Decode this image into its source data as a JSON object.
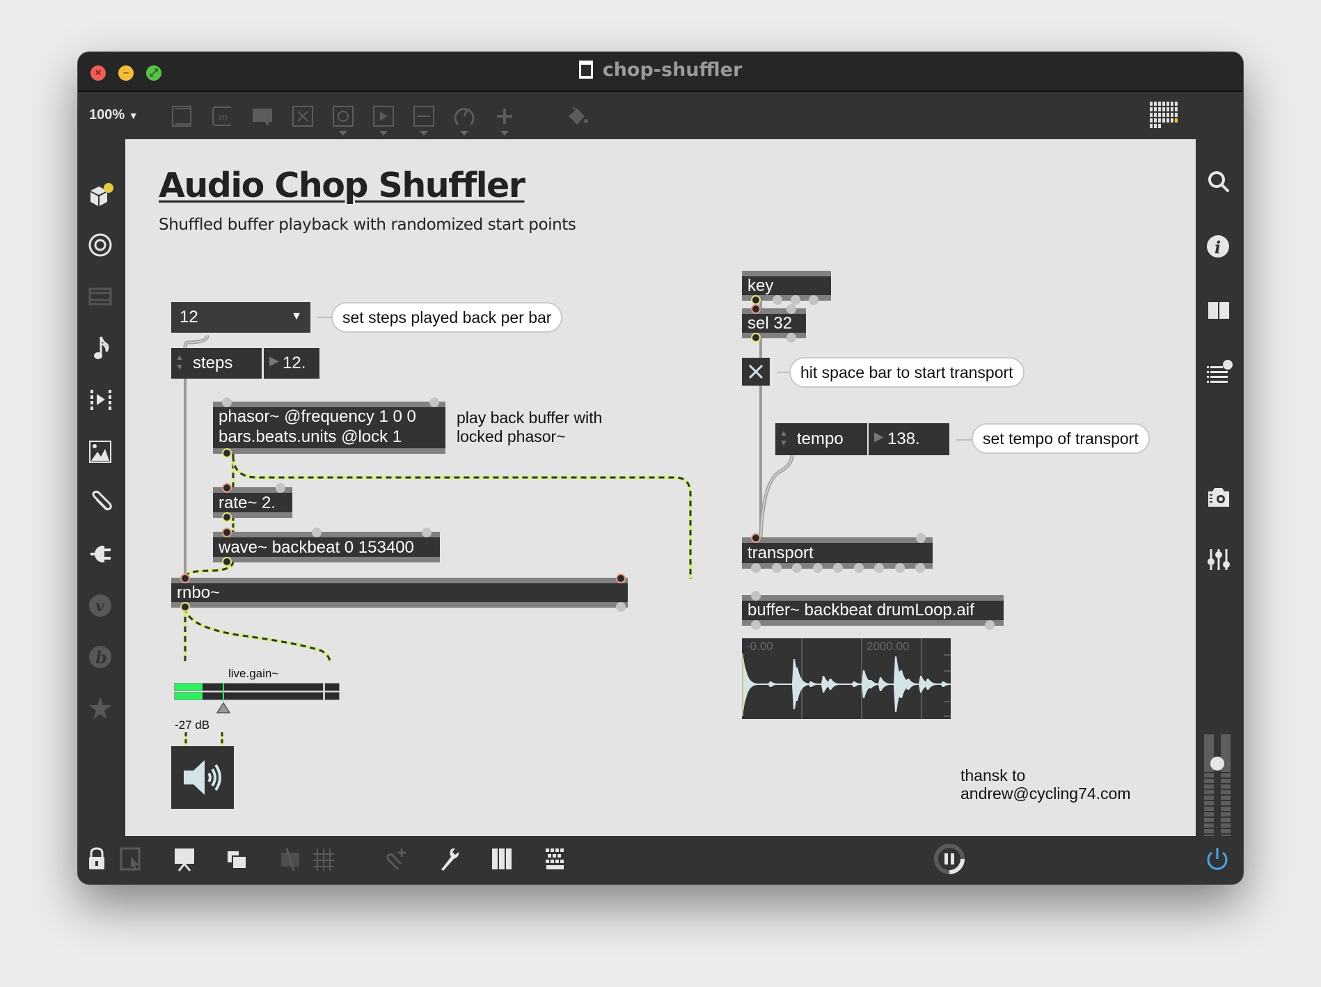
{
  "window": {
    "title": "chop-shuffler",
    "zoom": "100%"
  },
  "toolbar": {
    "icons": [
      "new-object-icon",
      "message-icon",
      "comment-icon",
      "toggle-icon",
      "button-icon",
      "number-icon",
      "slider-icon",
      "dial-icon",
      "add-icon",
      "paint-bucket-icon",
      "grid-icon"
    ]
  },
  "left_sidebar": {
    "icons": [
      "packages-icon",
      "target-icon",
      "tv-icon",
      "music-note-icon",
      "media-icon",
      "image-icon",
      "paperclip-icon",
      "plug-icon",
      "vst-icon",
      "bpatcher-icon",
      "star-icon"
    ]
  },
  "right_sidebar": {
    "icons": [
      "search-icon",
      "info-icon",
      "columns-icon",
      "list-icon",
      "snapshot-icon",
      "mixer-icon"
    ],
    "master_level": 0.84
  },
  "bottom_bar": {
    "icons": [
      "lock-icon",
      "presentation-select-icon",
      "presentation-icon",
      "layers-icon",
      "hide-icon",
      "grid-icon",
      "attach-icon",
      "wrench-icon",
      "piano-icon",
      "keyboard-icon",
      "pause-icon",
      "power-icon"
    ]
  },
  "patch": {
    "title": "Audio Chop Shuffler",
    "subtitle": "Shuffled buffer playback with randomized start points",
    "umenu_value": "12",
    "comment_steps": "set steps played back per bar",
    "steps_label": "steps",
    "steps_value": "12.",
    "phasor_line1": "phasor~ @frequency 1 0 0",
    "phasor_line2": "bars.beats.units @lock 1",
    "phasor_comment_line1": "play back buffer with",
    "phasor_comment_line2": "locked phasor~",
    "rate_obj": "rate~ 2.",
    "wave_obj": "wave~ backbeat 0 153400",
    "rnbo_obj": "rnbo~",
    "live_gain_label": "live.gain~",
    "live_gain_value": "-27 dB",
    "live_gain_level": 0.55,
    "key_obj": "key",
    "sel_obj": "sel 32",
    "comment_space": "hit space bar to start transport",
    "tempo_label": "tempo",
    "tempo_value": "138.",
    "comment_tempo": "set tempo of transport",
    "transport_obj": "transport",
    "buffer_obj": "buffer~ backbeat drumLoop.aif",
    "waveform_start": "-0.00",
    "waveform_mark": "2000.00",
    "credit_line1": "thansk to",
    "credit_line2": "andrew@cycling74.com"
  },
  "colors": {
    "signal_cord": "#d6f08a",
    "object_bg": "#333333",
    "canvas_bg": "#e4e4e4",
    "meter_green": "#2af060",
    "master_meter_blue": "#5aa7e8",
    "dsp_power": "#4aa3e8"
  }
}
